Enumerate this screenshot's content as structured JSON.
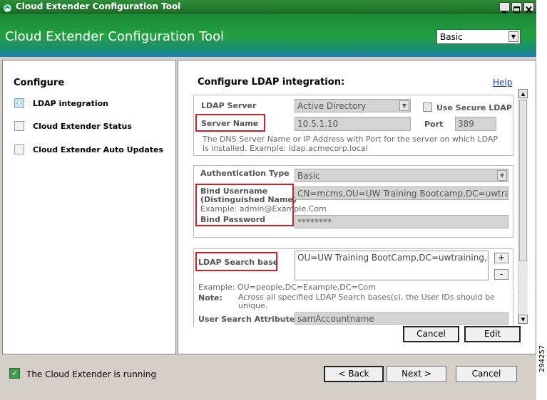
{
  "window": {
    "title": "Cloud Extender Configuration Tool",
    "header_title": "Cloud Extender Configuration Tool",
    "mode": "Basic"
  },
  "sidebar": {
    "heading": "Configure",
    "items": [
      {
        "label": "LDAP integration"
      },
      {
        "label": "Cloud Extender Status"
      },
      {
        "label": "Cloud Extender Auto Updates"
      }
    ]
  },
  "main": {
    "heading": "Configure LDAP integration:",
    "help": "Help",
    "ldap_server": {
      "label": "LDAP Server",
      "value": "Active Directory",
      "secure_label": "Use Secure LDAP",
      "server_name_label": "Server Name",
      "server_name_value": "10.5.1.10",
      "port_label": "Port",
      "port_value": "389",
      "note": "The DNS Server Name or IP Address with Port for the server on which LDAP is installed. Example: ldap.acmecorp.local"
    },
    "auth": {
      "type_label": "Authentication Type",
      "type_value": "Basic",
      "bind_user_label_1": "Bind Username",
      "bind_user_label_2": "(Distinguished Name)",
      "bind_user_value": "CN=mcms,OU=UW Training Bootcamp,DC=uwtraini",
      "example": "Example: admin@Example.Com",
      "bind_password_label": "Bind Password",
      "bind_password_value": "********"
    },
    "search": {
      "base_label": "LDAP Search base",
      "base_value": "OU=UW Training BootCamp,DC=uwtraining,DC",
      "add": "+",
      "remove": "-",
      "example": "Example: OU=people,DC=Example,DC=Com",
      "note_label": "Note:",
      "note_text": "Across all specified LDAP Search bases(s), the User IDs should be unique.",
      "attr_label": "User Search Attribute",
      "attr_value": "samAccountname"
    },
    "cancel": "Cancel",
    "edit": "Edit"
  },
  "footer": {
    "status": "The Cloud Extender is running",
    "back": "< Back",
    "next": "Next >",
    "cancel": "Cancel"
  },
  "figure_id": "294257"
}
